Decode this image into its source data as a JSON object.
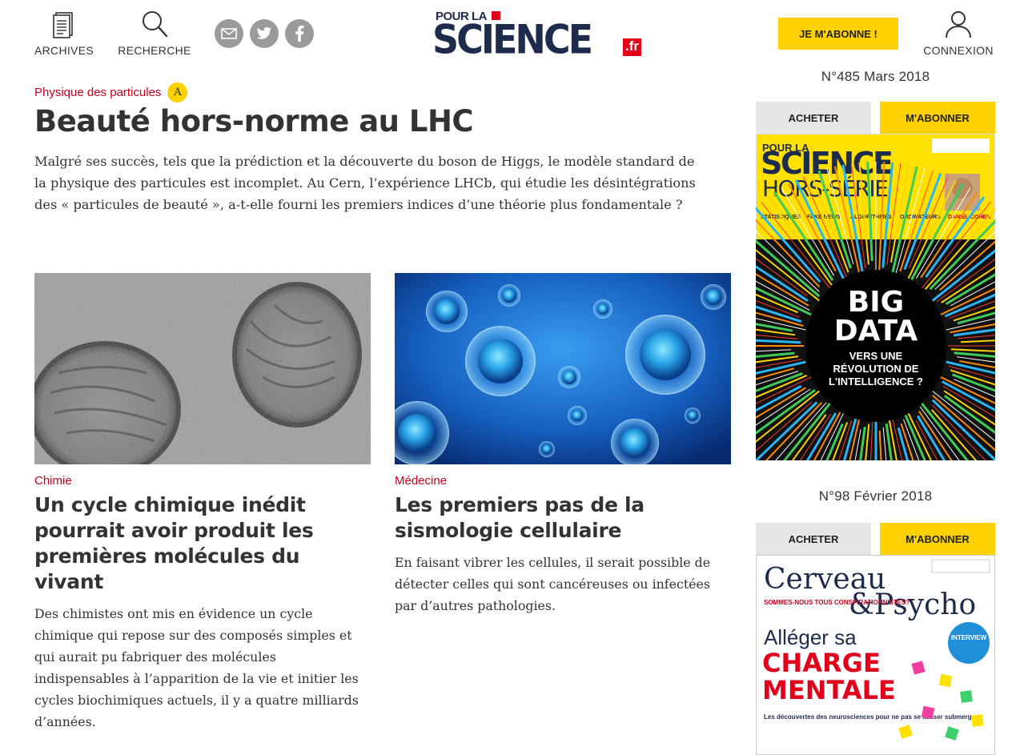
{
  "header": {
    "archives_label": "ARCHIVES",
    "search_label": "RECHERCHE",
    "login_label": "CONNEXION",
    "subscribe_label": "JE M'ABONNE !",
    "logo": {
      "pour_la": "POUR LA",
      "science": "SCIENCE",
      "tld": ".fr"
    },
    "social": [
      "mail-icon",
      "twitter-icon",
      "facebook-icon"
    ]
  },
  "hero": {
    "category": "Physique des particules",
    "access_badge": "A",
    "title": "Beauté hors-norme au LHC",
    "description": "Malgré ses succès, tels que la prédiction et la découverte du boson de Higgs, le modèle standard de la physique des particules est incomplet. Au Cern, l’expérience LHCb, qui étudie les désintégrations des « particules de beauté », a-t-elle fourni les premiers indices d’une théorie plus fondamentale ?"
  },
  "articles": [
    {
      "category": "Chimie",
      "title": "Un cycle chimique inédit pourrait avoir produit les premières molécules du vivant",
      "description": "Des chimistes ont mis en évidence un cycle chimique qui repose sur des composés simples et qui aurait pu fabriquer des molécules indispensables à l’apparition de la vie et initier les cycles biochimiques actuels, il y a quatre milliards d’années."
    },
    {
      "category": "Médecine",
      "title": "Les premiers pas de la sismologie cellulaire",
      "description": "En faisant vibrer les cellules, il serait possible de détecter celles qui sont cancéreuses ou infectées par d’autres pathologies."
    }
  ],
  "sidebar": {
    "issues": [
      {
        "number": "N°485 Mars 2018",
        "buy_label": "ACHETER",
        "subscribe_label": "M'ABONNER",
        "cover": {
          "brand_top": "POUR LA",
          "brand": "SCIENCE",
          "series": "HORS-SÉRIE",
          "topics": [
            "STATISTIQUES",
            "FAKE NEWS",
            "ALGORITHMES",
            "ORDINATEURS",
            "DANIEL COHEN"
          ],
          "headline_1": "BIG",
          "headline_2": "DATA",
          "sub_1": "VERS UNE",
          "sub_2": "RÉVOLUTION DE",
          "sub_3": "L'INTELLIGENCE ?"
        }
      },
      {
        "number": "N°98 Février 2018",
        "buy_label": "ACHETER",
        "subscribe_label": "M'ABONNER",
        "cover": {
          "brand_1": "Cerveau",
          "brand_2": "&Psycho",
          "teaser": "SOMMES-NOUS TOUS CONSPIRATIONNISTES?",
          "headline_1": "Alléger sa",
          "headline_2": "CHARGE",
          "headline_3": "MENTALE",
          "sub": "Les découvertes des neurosciences pour ne pas se laisser submerger",
          "badge": "INTERVIEW"
        }
      }
    ]
  },
  "colors": {
    "accent": "#ffd100",
    "category": "#c8001e",
    "brand": "#1d2b4c",
    "brand_red": "#e3001b"
  }
}
